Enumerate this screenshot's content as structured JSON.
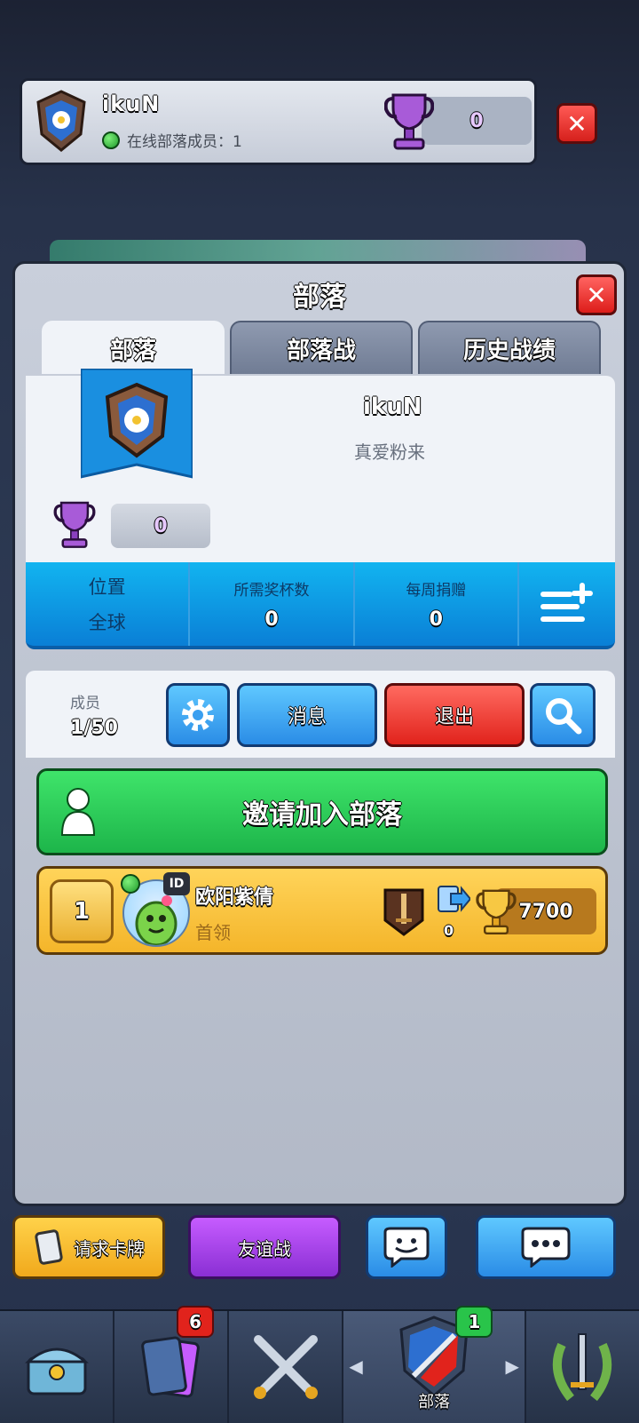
{
  "top_bar": {
    "clan_name": "ikuN",
    "online_members": "在线部落成员：1",
    "trophies": "0"
  },
  "panel": {
    "title": "部落",
    "tabs": [
      {
        "label": "部落"
      },
      {
        "label": "部落战"
      },
      {
        "label": "历史战绩"
      }
    ],
    "clan": {
      "name": "ikuN",
      "description": "真爱粉来",
      "trophies": "0"
    },
    "stats": {
      "location_label": "位置",
      "location_value": "全球",
      "required_label": "所需奖杯数",
      "required_value": "0",
      "weekly_label": "每周捐赠",
      "weekly_value": "0"
    },
    "members": {
      "label": "成员",
      "count": "1/50",
      "message_button": "消息",
      "leave_button": "退出"
    },
    "invite_button": "邀请加入部落",
    "member_list": [
      {
        "rank": "1",
        "name": "欧阳紫倩",
        "role": "首领",
        "donations": "0",
        "trophies": "7700",
        "id_badge": "ID"
      }
    ]
  },
  "actions": {
    "request_cards": "请求卡牌",
    "friendly_battle": "友谊战"
  },
  "nav": {
    "clan_label": "部落",
    "cards_badge": "6",
    "clan_badge": "1"
  },
  "colors": {
    "accent_blue": "#12b4f0",
    "invite_green": "#1db54a",
    "leader_gold": "#f4b52a",
    "close_red": "#e1231c"
  }
}
